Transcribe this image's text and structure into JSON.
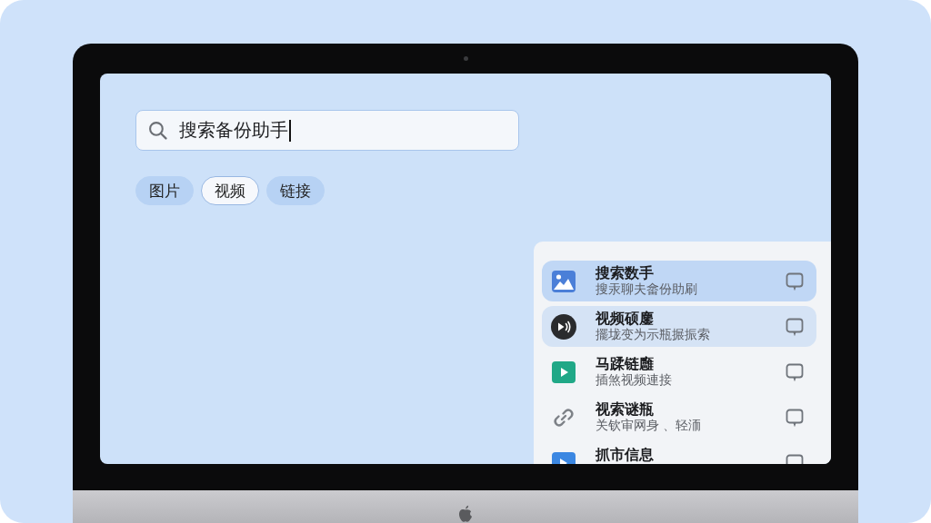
{
  "search": {
    "value": "搜索备份助手",
    "focused": true
  },
  "filters": [
    {
      "label": "图片",
      "selected": true
    },
    {
      "label": "视频",
      "selected": false
    },
    {
      "label": "链接",
      "selected": true
    }
  ],
  "results": [
    {
      "kind": "image",
      "title": "搜索数手",
      "subtitle": "搜汞聊夫畲份助刷",
      "selected": true,
      "hovered": false
    },
    {
      "kind": "audio",
      "title": "视频硕鏖",
      "subtitle": "擺垅变为示瓶搌振索",
      "selected": false,
      "hovered": true
    },
    {
      "kind": "video",
      "title": "马蹂链廱",
      "subtitle": "插煞视频連接",
      "selected": false,
      "hovered": false
    },
    {
      "kind": "link",
      "title": "视索谜瓶",
      "subtitle": "关钦审网身 、轻洏",
      "selected": false,
      "hovered": false
    },
    {
      "kind": "file",
      "title": "抓市信息",
      "selected": false,
      "hovered": false
    }
  ]
}
